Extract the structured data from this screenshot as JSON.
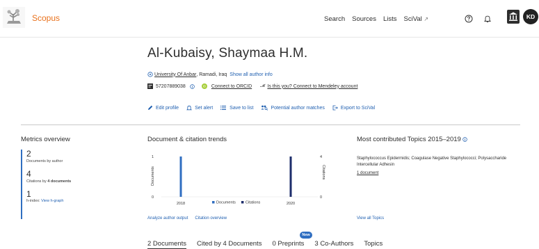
{
  "header": {
    "brand": "Scopus",
    "nav": [
      "Search",
      "Sources",
      "Lists",
      "SciVal"
    ],
    "scival_ext": "↗",
    "avatar_initials": "KD"
  },
  "author": {
    "name": "Al-Kubaisy, Shaymaa H.M.",
    "affiliation": "University Of Anbar",
    "location": ", Ramadi, Iraq",
    "show_all_info": "Show all author info",
    "author_id": "57207889038",
    "connect_orcid": "Connect to ORCID",
    "mendeley_prefix": "Is this you?",
    "mendeley_link": "Connect to Mendeley account"
  },
  "actions": [
    "Edit profile",
    "Set alert",
    "Save to list",
    "Potential author matches",
    "Export to SciVal"
  ],
  "metrics": {
    "title": "Metrics overview",
    "documents_value": "2",
    "documents_label": "Documents by author",
    "citations_value": "4",
    "citations_label_prefix": "Citations by",
    "citations_label_bold": "4 documents",
    "h_index_value": "1",
    "h_index_label": "h-index:",
    "view_h_graph": "View h-graph"
  },
  "trends": {
    "title": "Document & citation trends",
    "analyze_link": "Analyze author output",
    "citation_overview_link": "Citation overview"
  },
  "chart_data": {
    "type": "bar",
    "title": "Document & citation trends",
    "categories": [
      "2018",
      "2020"
    ],
    "series": [
      {
        "name": "Documents",
        "values": [
          1,
          0
        ],
        "axis": "left",
        "color": "#2f6ec1"
      },
      {
        "name": "Citations",
        "values": [
          0,
          4
        ],
        "axis": "right",
        "color": "#1d2d6b"
      }
    ],
    "ylabel_left": "Documents",
    "ylabel_right": "Citations",
    "ylim_left": [
      0,
      1
    ],
    "ylim_right": [
      0,
      4
    ],
    "left_ticks": [
      "1",
      "0"
    ],
    "right_ticks": [
      "4",
      "0"
    ],
    "legend_position": "bottom-center",
    "grid": false
  },
  "topics": {
    "title": "Most contributed Topics 2015–2019",
    "topic": "Staphylococcus Epidermidis; Coagulase Negative Staphylococci; Polysaccharide Intercellular Adhesin",
    "docs": "1 document",
    "view_all": "View all Topics"
  },
  "tabs": {
    "items": [
      "2 Documents",
      "Cited by 4 Documents",
      "0 Preprints",
      "3 Co-Authors",
      "Topics"
    ],
    "new_badge": "New"
  },
  "colors": {
    "brand": "#e9711c",
    "link": "#1f5fb0",
    "documents_bar": "#2f6ec1",
    "citations_bar": "#1d2d6b",
    "orcid": "#a6ce39"
  }
}
